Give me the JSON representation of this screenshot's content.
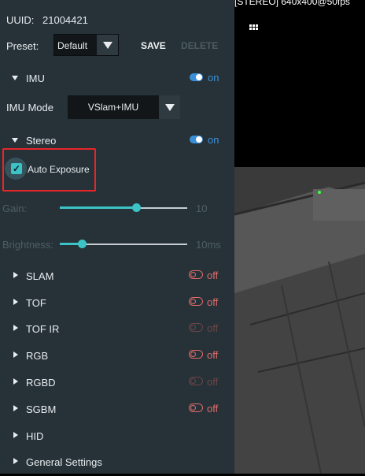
{
  "uuid": {
    "label": "UUID:",
    "value": "21004421"
  },
  "preset": {
    "label": "Preset:",
    "value": "Default",
    "save_label": "SAVE",
    "delete_label": "DELETE"
  },
  "imu": {
    "label": "IMU",
    "state": "on"
  },
  "imu_mode": {
    "label": "IMU Mode",
    "value": "VSlam+IMU"
  },
  "stereo": {
    "label": "Stereo",
    "state": "on"
  },
  "auto_exposure": {
    "label": "Auto Exposure",
    "checked": true
  },
  "gain": {
    "label": "Gain:",
    "value": "10",
    "level": 0.6
  },
  "brightness": {
    "label": "Brightness:",
    "value": "10ms",
    "level": 0.17
  },
  "sections": [
    {
      "label": "SLAM",
      "state": "off",
      "dim": false
    },
    {
      "label": "TOF",
      "state": "off",
      "dim": false
    },
    {
      "label": "TOF IR",
      "state": "off",
      "dim": true
    },
    {
      "label": "RGB",
      "state": "off",
      "dim": false
    },
    {
      "label": "RGBD",
      "state": "off",
      "dim": true
    },
    {
      "label": "SGBM",
      "state": "off",
      "dim": false
    },
    {
      "label": "HID"
    },
    {
      "label": "General Settings"
    }
  ],
  "video": {
    "title": "[STEREO]  640x400@50fps"
  },
  "icons": {
    "grid": "grid-icon",
    "chevron": "chevron-down-icon"
  },
  "colors": {
    "panel": "#263238",
    "accent_on": "#3b8fd9",
    "accent_off": "#e06c6c",
    "slider": "#3cc3c6",
    "highlight": "#e8262a"
  }
}
